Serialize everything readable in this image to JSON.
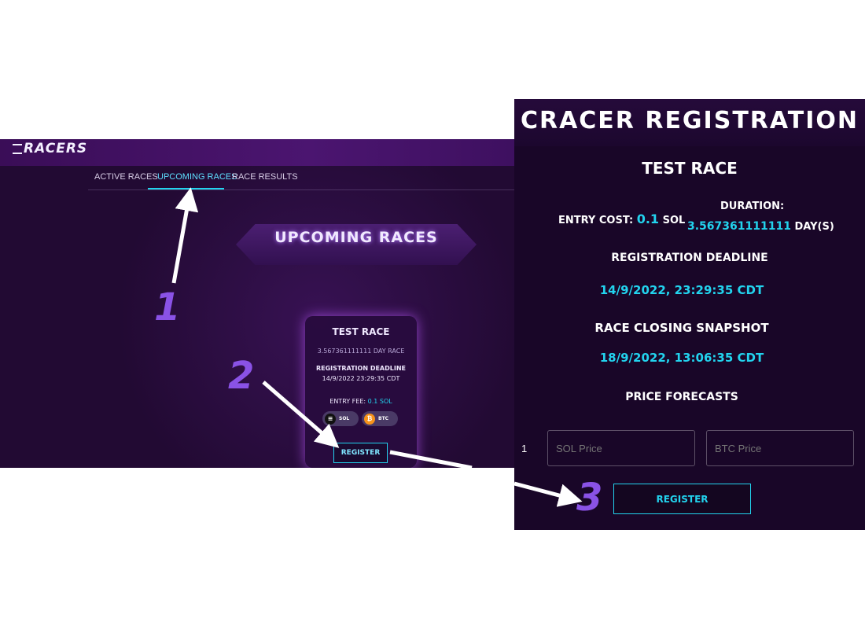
{
  "left_app": {
    "logo": "RACERS",
    "tabs": [
      {
        "label": "ACTIVE RACES",
        "active": false
      },
      {
        "label": "UPCOMING RACES",
        "active": true
      },
      {
        "label": "RACE RESULTS",
        "active": false
      }
    ],
    "banner_title": "UPCOMING RACES",
    "card": {
      "title": "TEST RACE",
      "duration": "3.567361111111 DAY RACE",
      "deadline_label": "REGISTRATION DEADLINE",
      "deadline_value": "14/9/2022 23:29:35 CDT",
      "entry_fee_label": "ENTRY FEE:",
      "entry_fee_value": "0.1 SOL",
      "tokens": [
        {
          "label": "SOL",
          "icon": "solana-icon",
          "color": "#111111"
        },
        {
          "label": "BTC",
          "icon": "bitcoin-icon",
          "color": "#f7931a"
        }
      ],
      "register_label": "REGISTER"
    }
  },
  "registration": {
    "title": "CRACER REGISTRATION",
    "race_name": "TEST RACE",
    "entry_cost_label": "ENTRY COST:",
    "entry_cost_value": "0.1",
    "entry_cost_unit": "SOL",
    "duration_label": "DURATION:",
    "duration_value": "3.567361111111",
    "duration_unit": "DAY(S)",
    "deadline_label": "REGISTRATION DEADLINE",
    "deadline_value": "14/9/2022, 23:29:35 CDT",
    "closing_label": "RACE CLOSING SNAPSHOT",
    "closing_value": "18/9/2022, 13:06:35 CDT",
    "forecast_label": "PRICE FORECASTS",
    "row_index": "1",
    "sol_placeholder": "SOL Price",
    "btc_placeholder": "BTC Price",
    "register_label": "REGISTER"
  },
  "annotations": {
    "step1": "1",
    "step2": "2",
    "step3": "3"
  },
  "colors": {
    "accent_cyan": "#22d3ee",
    "step_purple": "#8a52e6",
    "bg_dark": "#190628"
  }
}
